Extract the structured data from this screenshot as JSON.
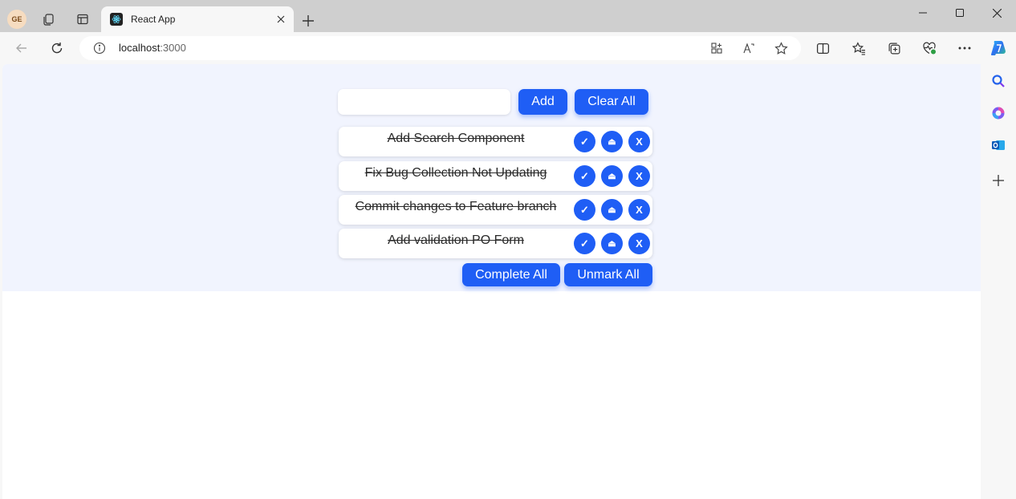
{
  "browser": {
    "profile_initials": "GE",
    "tab": {
      "title": "React App"
    },
    "address": {
      "host": "localhost",
      "port": ":3000"
    }
  },
  "app": {
    "input": {
      "value": "",
      "placeholder": ""
    },
    "add_label": "Add",
    "clear_all_label": "Clear All",
    "todos": [
      {
        "text": "Add Search Component",
        "completed": true
      },
      {
        "text": "Fix Bug Collection Not Updating",
        "completed": true
      },
      {
        "text": "Commit changes to Feature branch",
        "completed": true
      },
      {
        "text": "Add validation PO Form",
        "completed": true
      }
    ],
    "item_actions": {
      "complete": "✓",
      "undo": "⏏",
      "delete": "X"
    },
    "complete_all_label": "Complete All",
    "unmark_all_label": "Unmark All"
  },
  "colors": {
    "accent": "#1f5ef5",
    "app_background": "#f1f4fe",
    "browser_chrome": "#cfcfcf"
  }
}
